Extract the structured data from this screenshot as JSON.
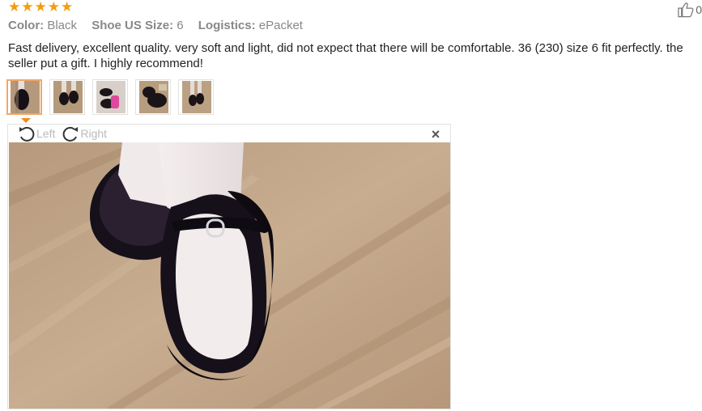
{
  "rating": {
    "stars": 5
  },
  "meta": {
    "color_label": "Color:",
    "color_value": "Black",
    "size_label": "Shoe US Size:",
    "size_value": "6",
    "logistics_label": "Logistics:",
    "logistics_value": "ePacket"
  },
  "helpful": {
    "icon": "thumbs-up-icon",
    "count": "0"
  },
  "review_text": "Fast delivery, excellent quality. very soft and light, did not expect that there will be comfortable. 36 (230) size 6 fit perfectly. the seller put a gift. I highly recommend!",
  "thumbnails": [
    {
      "name": "photo-1",
      "selected": true
    },
    {
      "name": "photo-2",
      "selected": false
    },
    {
      "name": "photo-3",
      "selected": false
    },
    {
      "name": "photo-4",
      "selected": false
    },
    {
      "name": "photo-5",
      "selected": false
    }
  ],
  "viewer": {
    "rotate_left_label": "Left",
    "rotate_right_label": "Right",
    "close_icon": "close-icon"
  },
  "colors": {
    "star": "#f39c12",
    "accent": "#f08a24",
    "floor": "#b89a7c"
  }
}
